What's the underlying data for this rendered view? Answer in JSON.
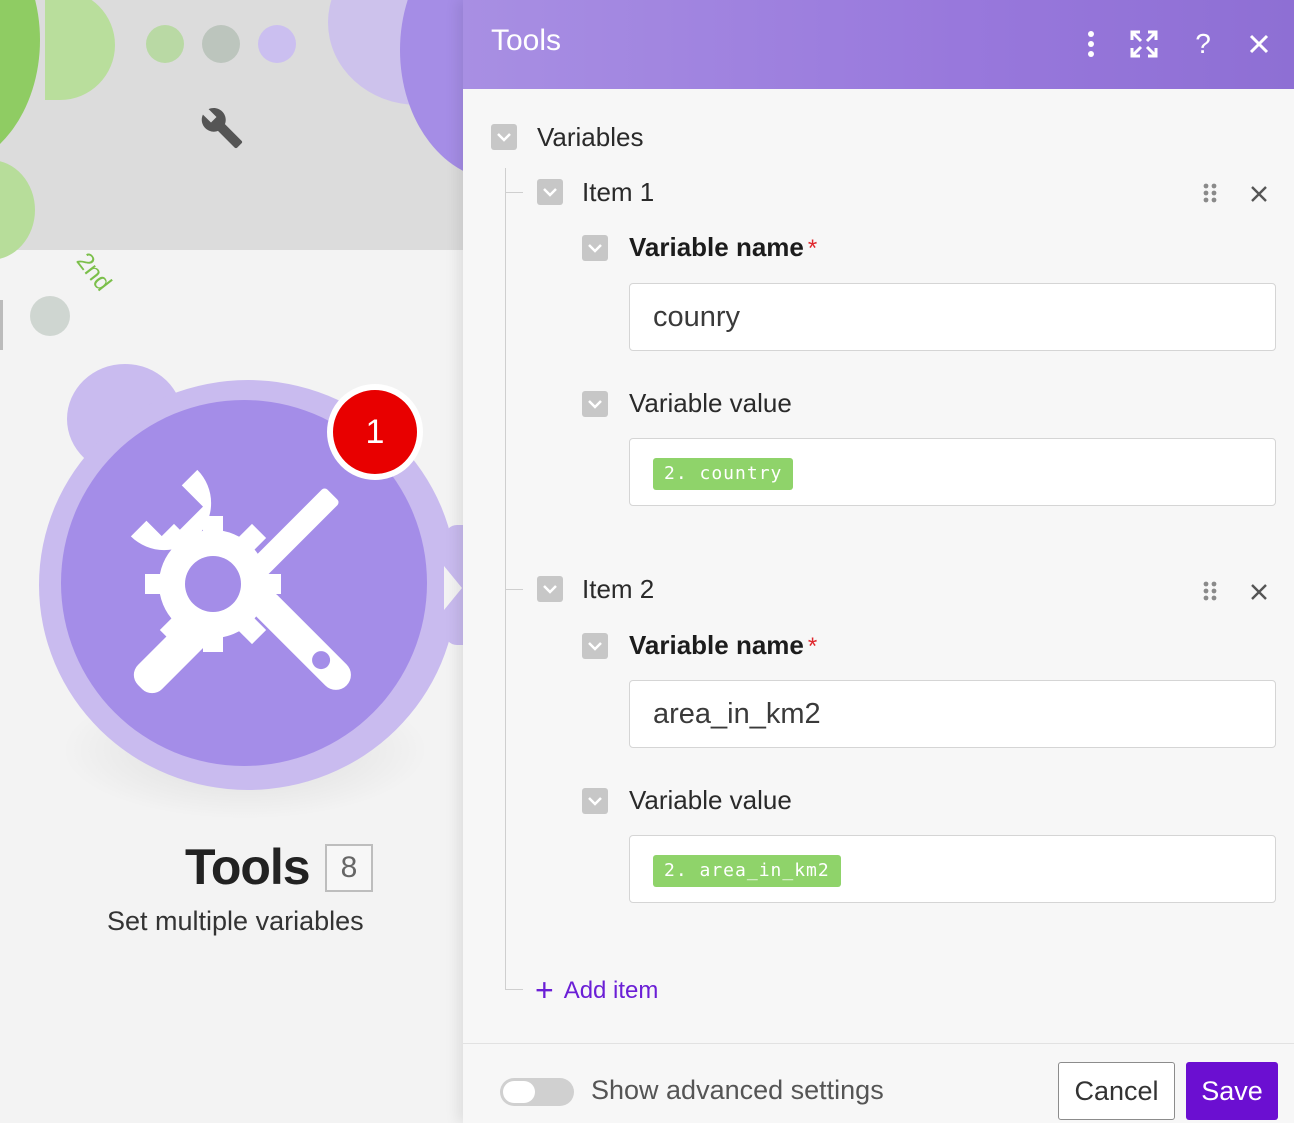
{
  "canvas": {
    "route_label": "2nd",
    "module": {
      "title": "Tools",
      "number": "8",
      "subtitle": "Set multiple variables",
      "badge_count": "1",
      "icon": "tools-icon",
      "color": "#a48de8"
    }
  },
  "panel": {
    "title": "Tools",
    "header_buttons": [
      "more-icon",
      "expand-icon",
      "help-icon",
      "close-icon"
    ],
    "help_glyph": "?",
    "section_label": "Variables",
    "items": [
      {
        "label": "Item 1",
        "name_label": "Variable name",
        "name_required_mark": "*",
        "name_value": "counry",
        "value_label": "Variable value",
        "value_pill": "2. country"
      },
      {
        "label": "Item 2",
        "name_label": "Variable name",
        "name_required_mark": "*",
        "name_value": "area_in_km2",
        "value_label": "Variable value",
        "value_pill": "2. area_in_km2"
      }
    ],
    "add_item_label": "Add item",
    "add_item_glyph": "+",
    "advanced_label": "Show advanced settings",
    "advanced_enabled": false,
    "cancel_label": "Cancel",
    "save_label": "Save",
    "colors": {
      "header": "#9878dc",
      "accent": "#6b0fd1",
      "pill": "#8fd36a",
      "required": "#e0282e"
    }
  }
}
